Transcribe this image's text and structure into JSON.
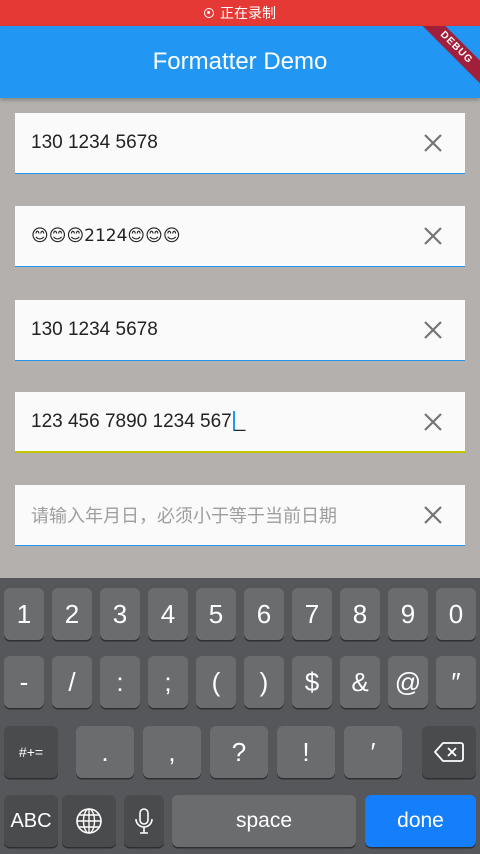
{
  "status_bar": {
    "recording_text": "正在录制"
  },
  "app_bar": {
    "title": "Formatter Demo",
    "debug_label": "DEBUG"
  },
  "fields": [
    {
      "value": "130 1234 5678",
      "placeholder": "",
      "focused": false
    },
    {
      "value": "😊😊😊2124😊😊😊",
      "placeholder": "",
      "focused": false
    },
    {
      "value": "130 1234 5678",
      "placeholder": "",
      "focused": false
    },
    {
      "value": "123 456 7890 1234 567",
      "suffix": "_",
      "placeholder": "",
      "focused": true
    },
    {
      "value": "",
      "placeholder": "请输入年月日，必须小于等于当前日期",
      "focused": false
    }
  ],
  "keyboard": {
    "row1": [
      "1",
      "2",
      "3",
      "4",
      "5",
      "6",
      "7",
      "8",
      "9",
      "0"
    ],
    "row2": [
      "-",
      "/",
      ":",
      ";",
      "(",
      ")",
      "$",
      "&",
      "@",
      "″"
    ],
    "row3": {
      "switch": "#+=",
      "keys": [
        ".",
        ",",
        "?",
        "!",
        "′"
      ],
      "delete": "backspace-icon"
    },
    "row4": {
      "abc": "ABC",
      "globe": "globe-icon",
      "mic": "mic-icon",
      "space": "space",
      "done": "done"
    }
  },
  "colors": {
    "accent": "#2196f3",
    "status": "#e53935",
    "done_key": "#157efb"
  }
}
